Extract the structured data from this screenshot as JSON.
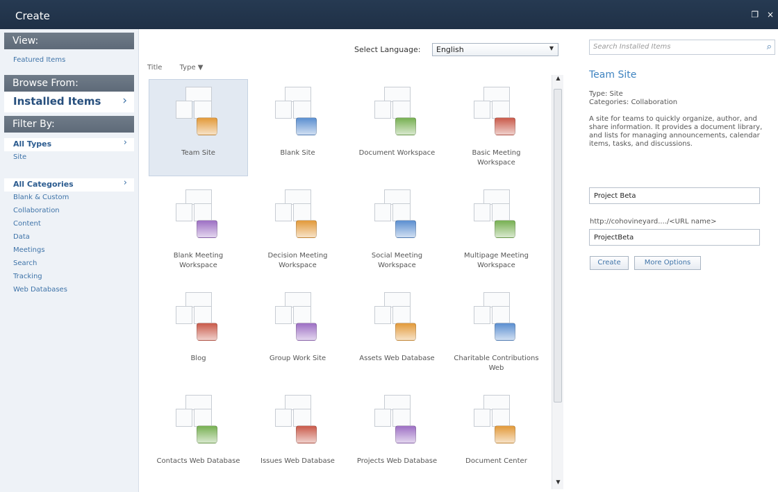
{
  "window": {
    "title": "Create",
    "restore_symbol": "❐",
    "close_symbol": "×"
  },
  "leftnav": {
    "view_header": "View:",
    "view_items": [
      "Featured Items"
    ],
    "browse_header": "Browse From:",
    "browse_selected": "Installed Items",
    "filter_header": "Filter By:",
    "type_selected": "All Types",
    "type_items": [
      "Site"
    ],
    "category_selected": "All Categories",
    "category_items": [
      "Blank & Custom",
      "Collaboration",
      "Content",
      "Data",
      "Meetings",
      "Search",
      "Tracking",
      "Web Databases"
    ],
    "chevron": "›"
  },
  "center": {
    "language_label": "Select Language:",
    "language_value": "English",
    "sort_title": "Title",
    "sort_type": "Type ▼",
    "tiles": [
      {
        "label": "Team Site",
        "icon": "team-site-icon"
      },
      {
        "label": "Blank Site",
        "icon": "blank-site-icon"
      },
      {
        "label": "Document Workspace",
        "icon": "document-workspace-icon"
      },
      {
        "label": "Basic Meeting Workspace",
        "icon": "basic-meeting-workspace-icon"
      },
      {
        "label": "Blank Meeting Workspace",
        "icon": "blank-meeting-workspace-icon"
      },
      {
        "label": "Decision Meeting Workspace",
        "icon": "decision-meeting-workspace-icon"
      },
      {
        "label": "Social Meeting Workspace",
        "icon": "social-meeting-workspace-icon"
      },
      {
        "label": "Multipage Meeting Workspace",
        "icon": "multipage-meeting-workspace-icon"
      },
      {
        "label": "Blog",
        "icon": "blog-icon"
      },
      {
        "label": "Group Work Site",
        "icon": "group-work-site-icon"
      },
      {
        "label": "Assets Web Database",
        "icon": "assets-web-database-icon"
      },
      {
        "label": "Charitable Contributions Web",
        "icon": "charitable-contributions-icon"
      },
      {
        "label": "Contacts Web Database",
        "icon": "contacts-web-database-icon"
      },
      {
        "label": "Issues Web Database",
        "icon": "issues-web-database-icon"
      },
      {
        "label": "Projects Web Database",
        "icon": "projects-web-database-icon"
      },
      {
        "label": "Document Center",
        "icon": "document-center-icon"
      }
    ]
  },
  "right": {
    "search_placeholder": "Search Installed Items",
    "search_icon": "⌕",
    "title": "Team Site",
    "type_line": "Type: Site",
    "categories_line": "Categories: Collaboration",
    "description": "A site for teams to quickly organize, author, and share information. It provides a document library, and lists for managing announcements, calendar items, tasks, and discussions.",
    "name_value": "Project Beta",
    "url_hint": "http://cohovineyard..../<URL name>",
    "url_value": "ProjectBeta",
    "create_label": "Create",
    "more_options_label": "More Options"
  },
  "colors": {
    "accent": "#3e73a8",
    "titlebar": "#263a52",
    "selected_tile": "#e2e9f2"
  }
}
